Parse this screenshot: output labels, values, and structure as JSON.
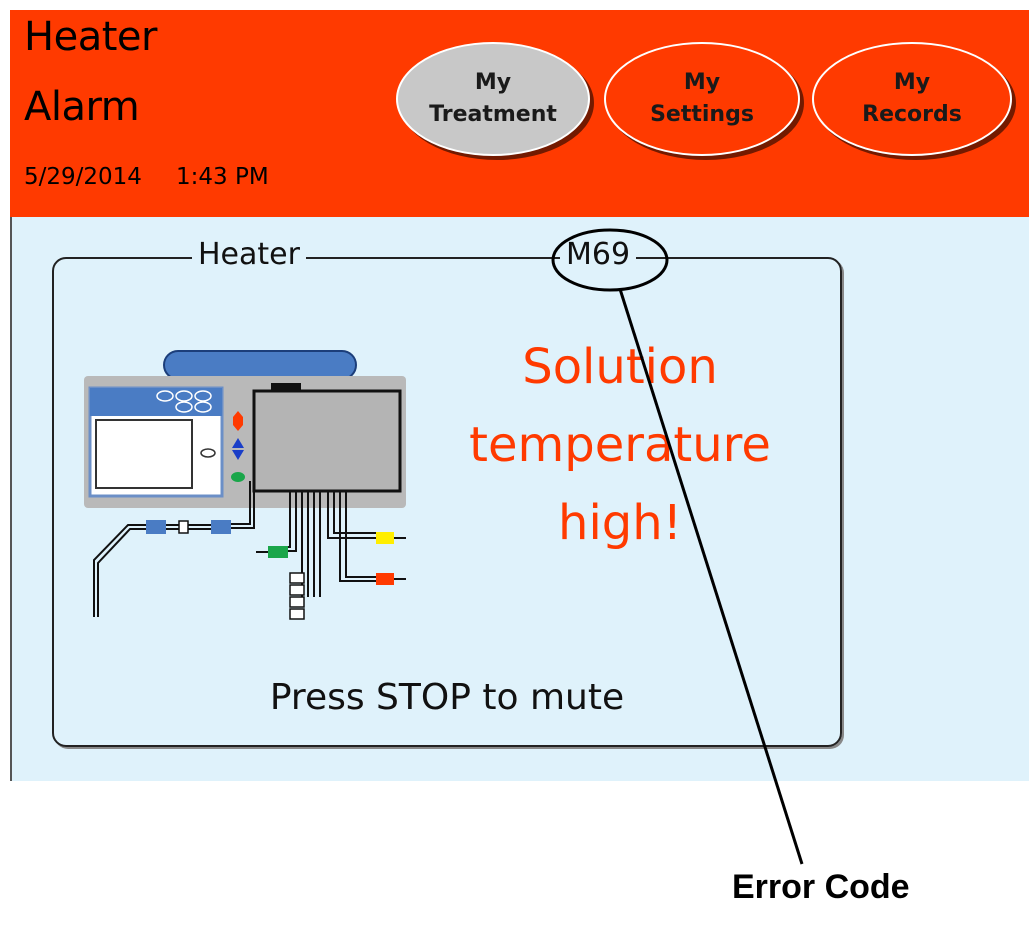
{
  "header": {
    "title_line1": "Heater",
    "title_line2": "Alarm",
    "date": "5/29/2014",
    "time": "1:43 PM",
    "background_color": "#ff3a00"
  },
  "nav": {
    "treatment": {
      "line1": "My",
      "line2": "Treatment",
      "selected": true
    },
    "settings": {
      "line1": "My",
      "line2": "Settings",
      "selected": false
    },
    "records": {
      "line1": "My",
      "line2": "Records",
      "selected": false
    }
  },
  "panel": {
    "group_label": "Heater",
    "error_code": "M69",
    "alarm_message": [
      "Solution",
      "temperature",
      "high!"
    ],
    "alarm_color": "#ff3a00",
    "mute_instruction": "Press STOP to mute",
    "illustration": "cycler-device-icon"
  },
  "annotation": {
    "label": "Error Code"
  }
}
